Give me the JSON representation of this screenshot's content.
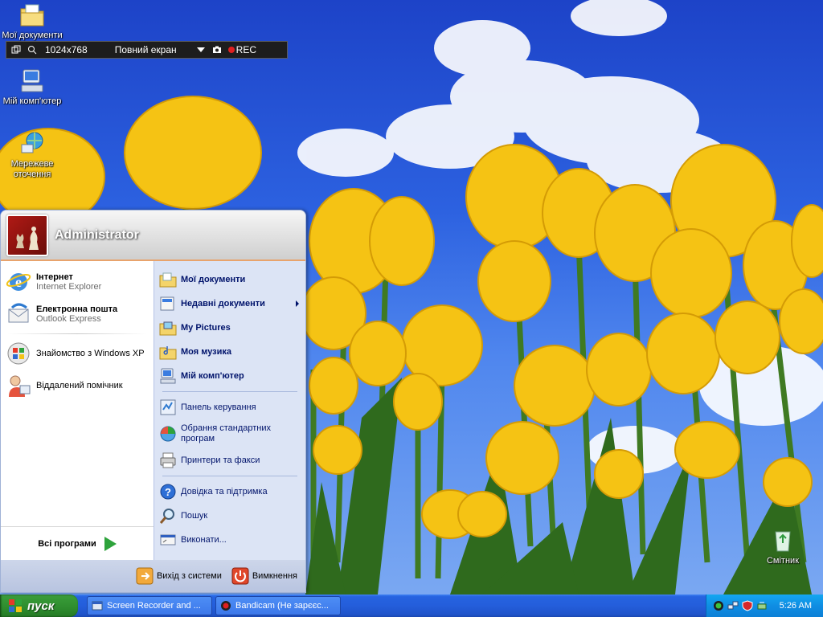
{
  "desktop": {
    "icons": [
      {
        "label": "Мої документи",
        "icon": "folder-documents-icon"
      },
      {
        "label": "Мій комп'ютер",
        "icon": "computer-icon"
      },
      {
        "label": "Мережеве оточення",
        "icon": "network-icon"
      },
      {
        "label": "Смітник",
        "icon": "recycle-bin-icon"
      }
    ]
  },
  "bandicam": {
    "resolution": "1024x768",
    "mode": "Повний екран",
    "rec": "REC"
  },
  "start_menu": {
    "user": "Administrator",
    "pinned": [
      {
        "title": "Інтернет",
        "subtitle": "Internet Explorer",
        "icon": "internet-explorer-icon"
      },
      {
        "title": "Електронна пошта",
        "subtitle": "Outlook Express",
        "icon": "outlook-express-icon"
      }
    ],
    "recent": [
      {
        "label": "Знайомство з Windows XP",
        "icon": "windows-tour-icon"
      },
      {
        "label": "Віддалений помічник",
        "icon": "remote-assistance-icon"
      }
    ],
    "all_programs": "Всі програми",
    "places": [
      {
        "label": "Мої документи",
        "icon": "my-documents-icon"
      },
      {
        "label": "Недавні документи",
        "icon": "recent-documents-icon"
      },
      {
        "label": "My Pictures",
        "icon": "my-pictures-icon"
      },
      {
        "label": "Моя музика",
        "icon": "my-music-icon"
      },
      {
        "label": "Мій комп'ютер",
        "icon": "my-computer-icon"
      }
    ],
    "settings": [
      {
        "label": "Панель керування",
        "icon": "control-panel-icon"
      },
      {
        "label": "Обрання стандартних програм",
        "icon": "default-programs-icon"
      },
      {
        "label": "Принтери та факси",
        "icon": "printers-icon"
      }
    ],
    "help": [
      {
        "label": "Довідка та підтримка",
        "icon": "help-icon"
      },
      {
        "label": "Пошук",
        "icon": "search-icon"
      },
      {
        "label": "Виконати...",
        "icon": "run-icon"
      }
    ],
    "logoff": "Вихід з системи",
    "shutdown": "Вимкнення"
  },
  "taskbar": {
    "start": "пуск",
    "tasks": [
      {
        "label": "Screen Recorder and ...",
        "icon": "screen-recorder-icon"
      },
      {
        "label": "Bandicam (Не зарєєс...",
        "icon": "bandicam-icon"
      }
    ],
    "clock": "5:26 AM"
  }
}
